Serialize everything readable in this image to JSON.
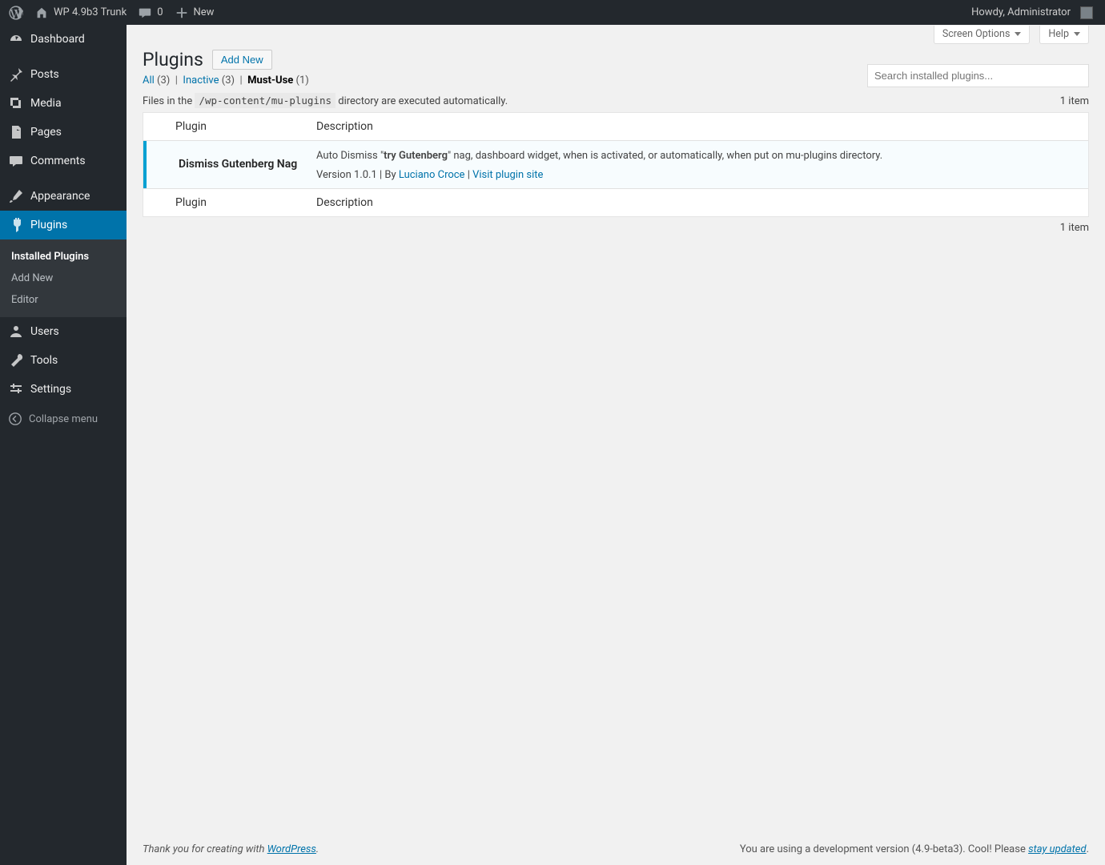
{
  "toolbar": {
    "site_name": "WP 4.9b3 Trunk",
    "comments_count": "0",
    "new_label": "New",
    "howdy": "Howdy, Administrator"
  },
  "sidebar": {
    "items": [
      {
        "label": "Dashboard"
      },
      {
        "label": "Posts"
      },
      {
        "label": "Media"
      },
      {
        "label": "Pages"
      },
      {
        "label": "Comments"
      },
      {
        "label": "Appearance"
      },
      {
        "label": "Plugins"
      },
      {
        "label": "Users"
      },
      {
        "label": "Tools"
      },
      {
        "label": "Settings"
      }
    ],
    "plugins_submenu": [
      {
        "label": "Installed Plugins",
        "current": true
      },
      {
        "label": "Add New"
      },
      {
        "label": "Editor"
      }
    ],
    "collapse_label": "Collapse menu"
  },
  "screen_meta": {
    "screen_options": "Screen Options",
    "help": "Help"
  },
  "page": {
    "title": "Plugins",
    "add_new": "Add New",
    "filters": {
      "all_label": "All",
      "all_count": "(3)",
      "inactive_label": "Inactive",
      "inactive_count": "(3)",
      "mustuse_label": "Must-Use",
      "mustuse_count": "(1)"
    },
    "search_placeholder": "Search installed plugins...",
    "info_pre": "Files in the ",
    "info_code": "/wp-content/mu-plugins",
    "info_post": " directory are executed automatically.",
    "item_count": "1 item",
    "cols": {
      "plugin": "Plugin",
      "description": "Description"
    },
    "row": {
      "name": "Dismiss Gutenberg Nag",
      "desc_pre": "Auto Dismiss \"",
      "desc_strong": "try Gutenberg",
      "desc_post": "\" nag, dashboard widget, when is activated, or automatically, when put on mu-plugins directory.",
      "version_by": "Version 1.0.1 | By ",
      "author": "Luciano Croce",
      "sep": " | ",
      "visit": "Visit plugin site"
    }
  },
  "footer": {
    "left_pre": "Thank you for creating with ",
    "left_link": "WordPress",
    "left_post": ".",
    "right_pre": "You are using a development version (4.9-beta3). Cool! Please ",
    "right_link": "stay updated",
    "right_post": "."
  }
}
